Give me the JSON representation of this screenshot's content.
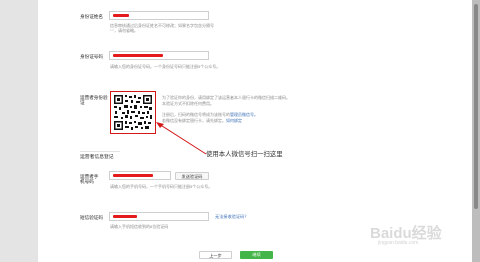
{
  "form": {
    "id_name_label": "身份证姓名",
    "id_name_hint": "信息审核通过后身份证姓名不可修改；如果名字包含分隔号 “·”，请勿省略。",
    "id_number_label": "身份证号码",
    "id_number_hint": "请输入您的身份证号码。一个身份证号码只能注册5个公众号。",
    "verify_label": "运营者身份验证",
    "verify_note_1": "为了验证你的身份，请用绑定了该运营者本人银行卡的微信扫描二维码。本验证方式不扣除任何费用。",
    "verify_note_2": "注册后，扫码的微信号将成为该账号的",
    "verify_note_2_link": "管理员微信号。",
    "verify_note_3": "若微信没有绑定银行卡，请先绑定。",
    "verify_note_3_link": "如何绑定",
    "section_title": "运营者信息登记",
    "phone_label": "运营者手机号码",
    "phone_hint": "请输入您的手机号码，一个手机号码只能注册5个公众号。",
    "send_code_button": "发送验证码",
    "sms_label": "短信验证码",
    "sms_link": "无法接收验证码？",
    "sms_hint": "请输入手机短信收到的6位验证码",
    "prev_button": "上一步",
    "next_button": "继续"
  },
  "annotation": {
    "text": "使用本人微信号扫一扫这里"
  },
  "watermark": {
    "text": "Baidu经验",
    "sub": "jingyan.baidu.com"
  },
  "colors": {
    "redaction": "#e41b1b",
    "primary_button": "#44b549",
    "link": "#3b6fb6"
  }
}
